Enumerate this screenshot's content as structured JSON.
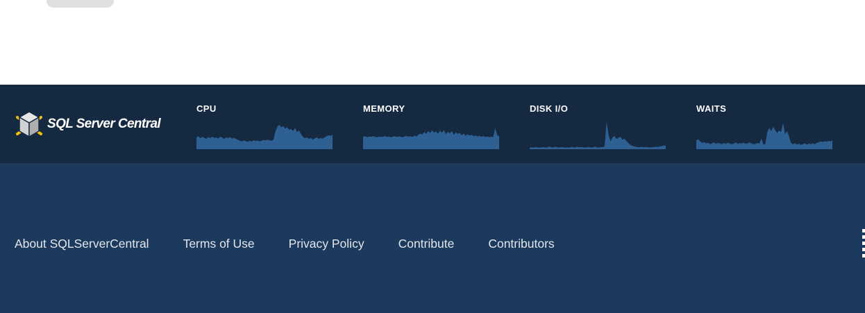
{
  "brand": {
    "name": "SQL Server Central"
  },
  "colors": {
    "band_dark": "#152940",
    "band_light": "#1c3a5e",
    "chart_fill": "#2e6094",
    "link_text": "#e3e6ea",
    "logo_yellow": "#f1c40f",
    "top_button_gray": "#e0e0e0"
  },
  "monitors": [
    {
      "label": "CPU",
      "values": [
        38,
        42,
        35,
        40,
        36,
        33,
        39,
        35,
        41,
        36,
        38,
        34,
        40,
        37,
        33,
        38,
        35,
        39,
        34,
        37,
        33,
        30,
        27,
        25,
        28,
        26,
        24,
        27,
        25,
        29,
        26,
        28,
        25,
        27,
        30,
        28,
        31,
        29,
        27,
        30,
        55,
        72,
        78,
        70,
        74,
        66,
        70,
        62,
        65,
        58,
        68,
        55,
        60,
        48,
        40,
        35,
        38,
        33,
        36,
        31,
        35,
        38,
        33,
        36,
        34,
        38,
        42,
        45,
        43,
        46
      ]
    },
    {
      "label": "MEMORY",
      "values": [
        40,
        42,
        38,
        41,
        39,
        42,
        40,
        38,
        41,
        39,
        40,
        42,
        39,
        41,
        38,
        40,
        42,
        39,
        41,
        40,
        38,
        41,
        43,
        40,
        42,
        39,
        44,
        41,
        46,
        50,
        47,
        55,
        49,
        58,
        52,
        60,
        54,
        57,
        50,
        59,
        53,
        61,
        48,
        56,
        51,
        58,
        46,
        54,
        49,
        52,
        45,
        50,
        43,
        48,
        44,
        46,
        42,
        44,
        41,
        43,
        40,
        42,
        39,
        41,
        38,
        40,
        39,
        68,
        45,
        42
      ]
    },
    {
      "label": "DISK I/O",
      "values": [
        5,
        6,
        5,
        7,
        6,
        5,
        6,
        7,
        5,
        6,
        8,
        6,
        5,
        8,
        6,
        5,
        7,
        6,
        5,
        6,
        5,
        7,
        6,
        5,
        8,
        6,
        7,
        6,
        5,
        6,
        7,
        5,
        6,
        8,
        6,
        5,
        7,
        6,
        10,
        88,
        45,
        25,
        38,
        42,
        33,
        36,
        40,
        30,
        34,
        27,
        20,
        14,
        11,
        9,
        8,
        7,
        6,
        8,
        6,
        7,
        6,
        5,
        7,
        6,
        8,
        7,
        9,
        10,
        12,
        11
      ]
    },
    {
      "label": "WAITS",
      "values": [
        28,
        32,
        25,
        20,
        23,
        18,
        21,
        16,
        19,
        22,
        17,
        20,
        18,
        16,
        20,
        17,
        21,
        18,
        16,
        18,
        22,
        17,
        20,
        18,
        21,
        17,
        19,
        22,
        18,
        16,
        17,
        20,
        18,
        35,
        15,
        17,
        55,
        68,
        58,
        72,
        62,
        52,
        60,
        55,
        85,
        48,
        58,
        42,
        20,
        16,
        19,
        15,
        18,
        14,
        16,
        19,
        15,
        18,
        16,
        19,
        16,
        20,
        22,
        25,
        23,
        26,
        24,
        27,
        25,
        28
      ]
    }
  ],
  "footer_links": [
    {
      "label": "About SQLServerCentral"
    },
    {
      "label": "Terms of Use"
    },
    {
      "label": "Privacy Policy"
    },
    {
      "label": "Contribute"
    },
    {
      "label": "Contributors"
    }
  ]
}
